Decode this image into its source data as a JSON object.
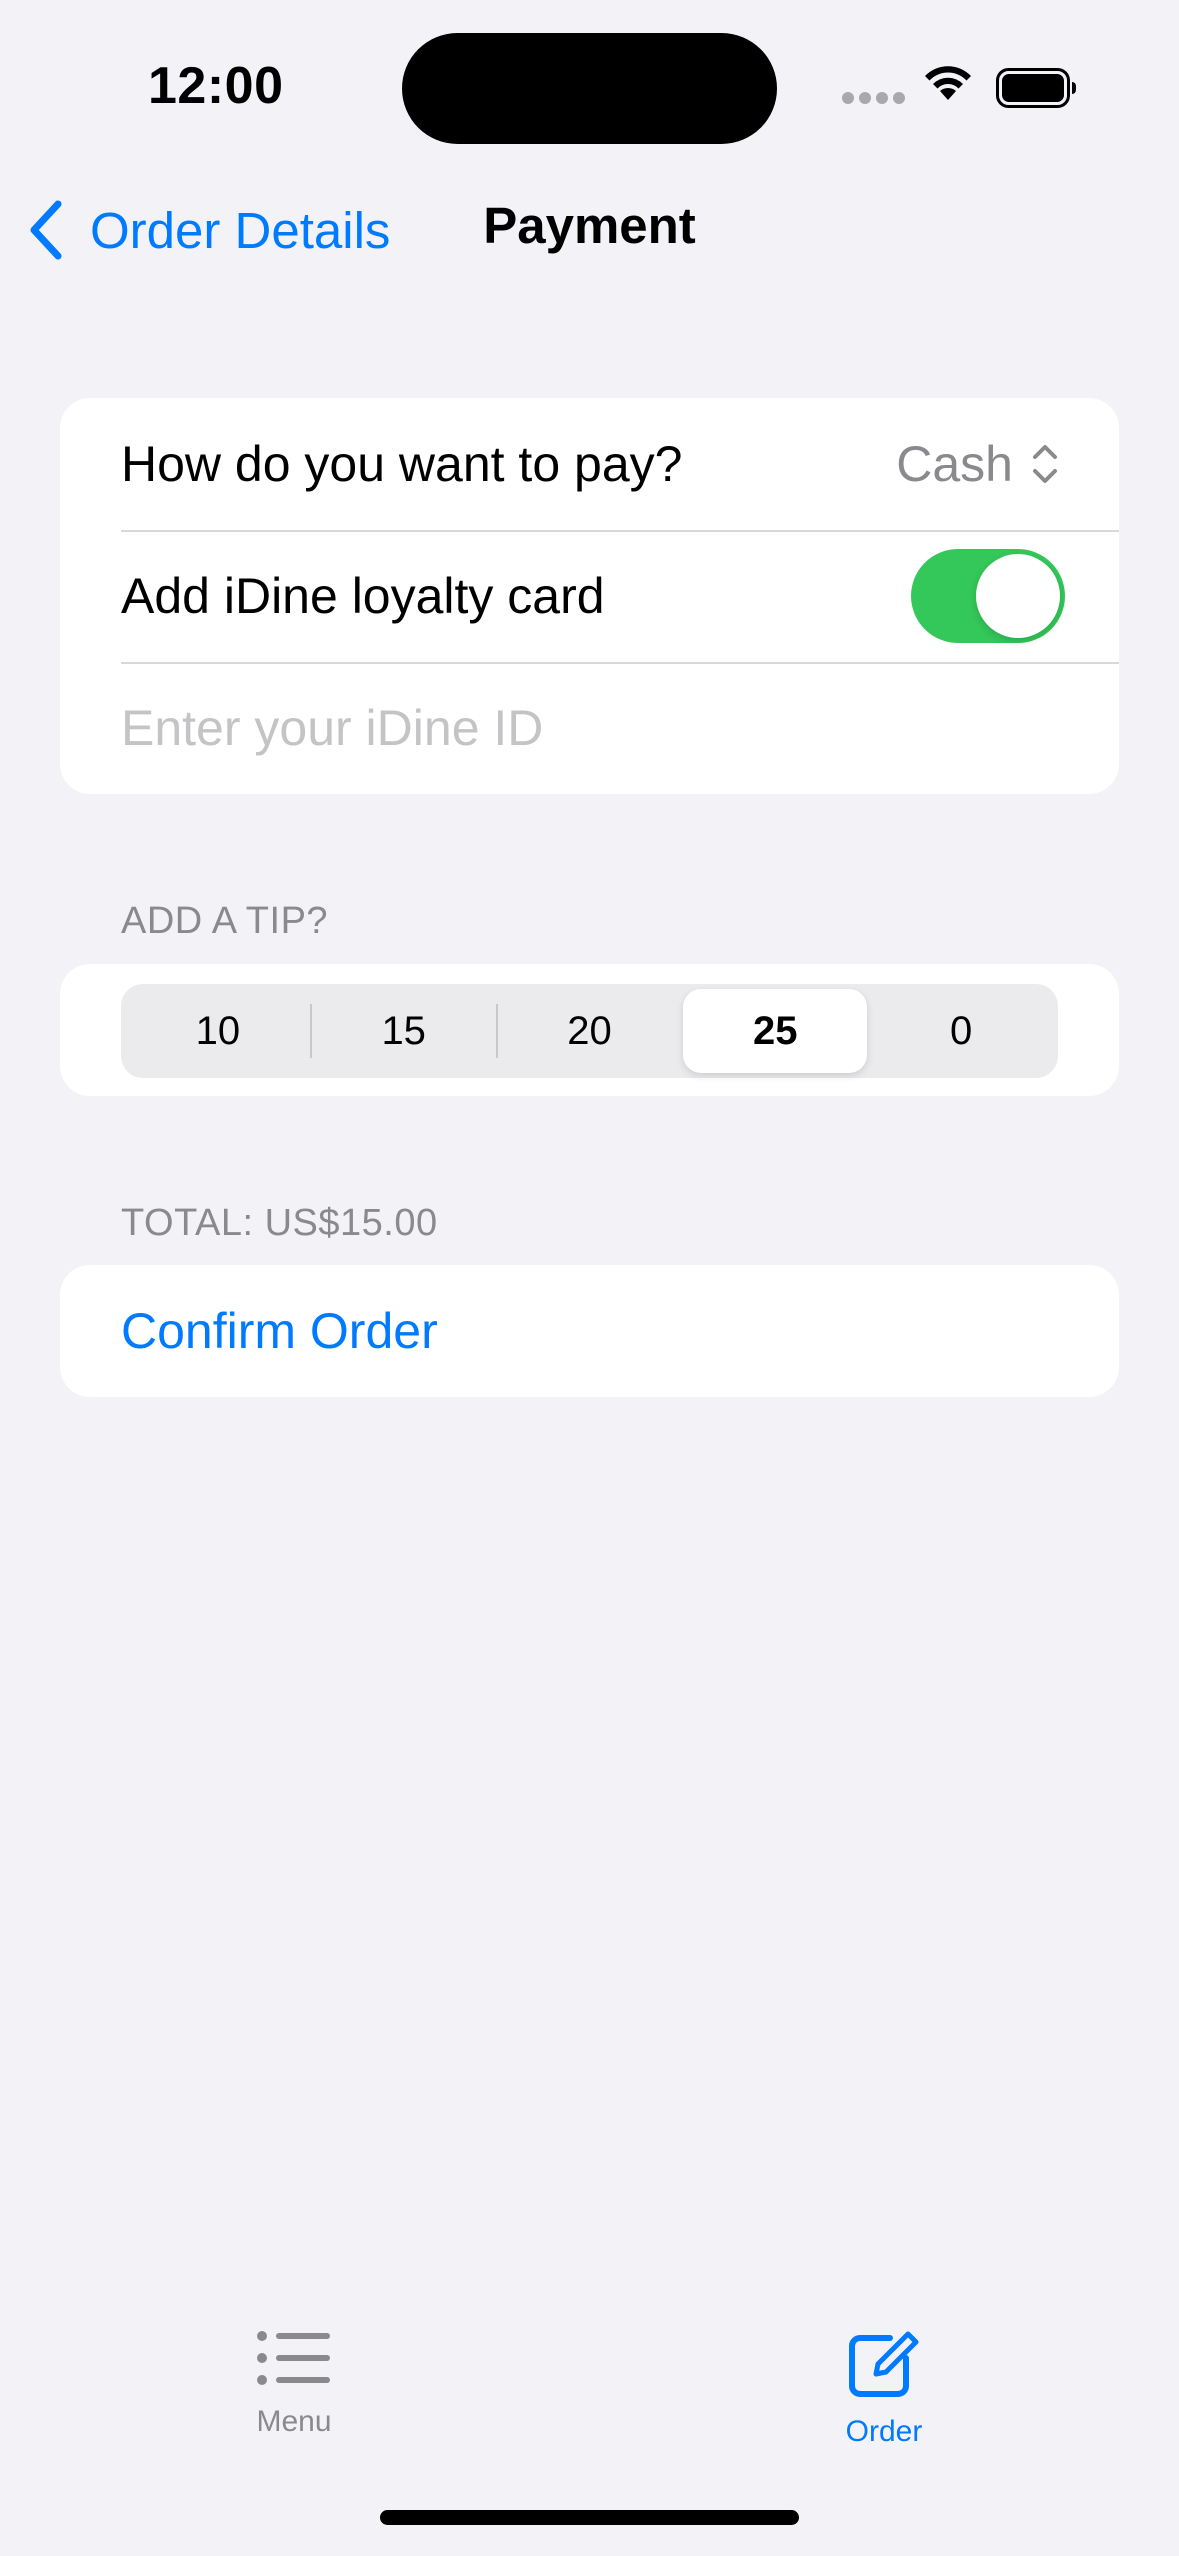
{
  "status_bar": {
    "time": "12:00"
  },
  "nav": {
    "back_label": "Order Details",
    "title": "Payment"
  },
  "payment": {
    "method_label": "How do you want to pay?",
    "method_value": "Cash",
    "loyalty_label": "Add iDine loyalty card",
    "loyalty_enabled": true,
    "id_placeholder": "Enter your iDine ID",
    "id_value": ""
  },
  "tip": {
    "header": "ADD A TIP?",
    "options": [
      "10",
      "15",
      "20",
      "25",
      "0"
    ],
    "selected": "25"
  },
  "total": {
    "header": "TOTAL: US$15.00",
    "confirm_label": "Confirm Order"
  },
  "tabs": [
    {
      "label": "Menu",
      "icon": "list-icon",
      "active": false
    },
    {
      "label": "Order",
      "icon": "square-and-pencil-icon",
      "active": true
    }
  ],
  "colors": {
    "accent": "#007AFF",
    "toggle_on": "#34C759",
    "background": "#F2F2F7",
    "secondary_text": "#8A8A8E"
  }
}
